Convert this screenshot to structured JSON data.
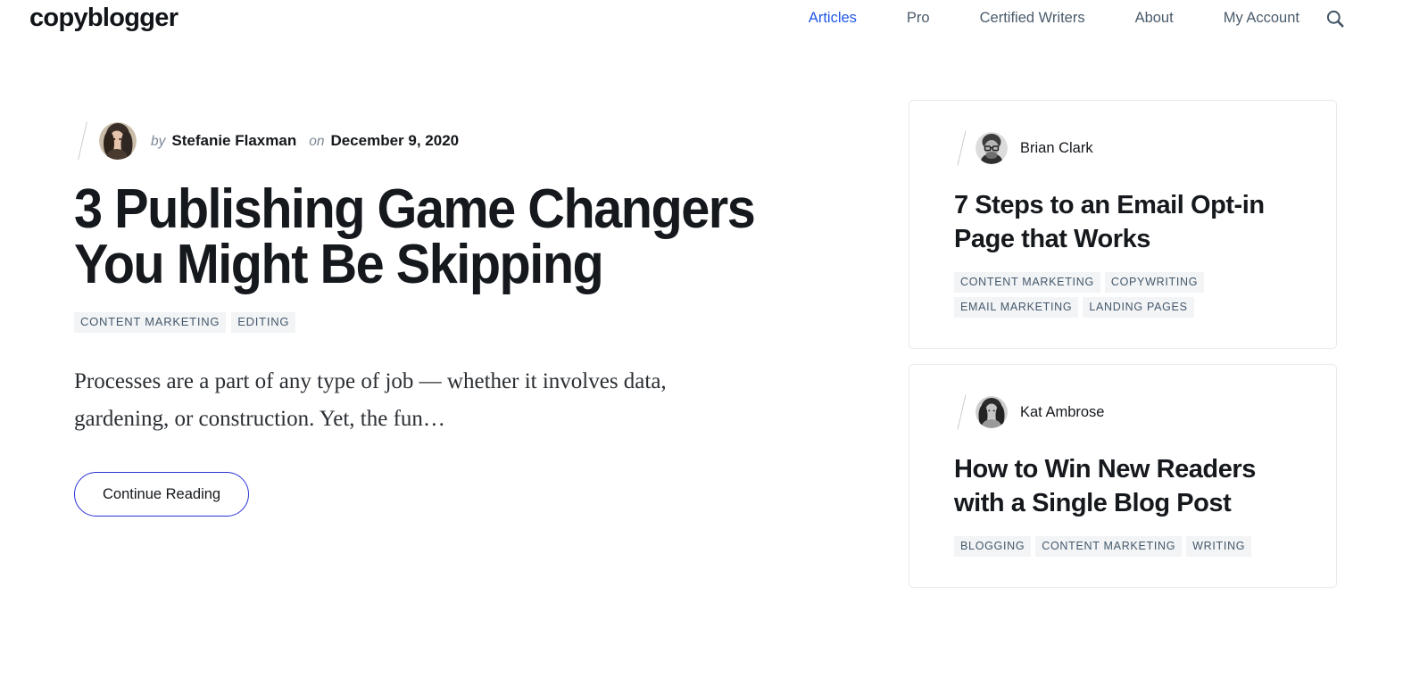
{
  "header": {
    "brand": "copyblogger",
    "nav": [
      {
        "label": "Articles",
        "active": true
      },
      {
        "label": "Pro",
        "active": false
      },
      {
        "label": "Certified Writers",
        "active": false
      },
      {
        "label": "About",
        "active": false
      },
      {
        "label": "My Account",
        "active": false
      }
    ],
    "search_icon": "search-icon"
  },
  "featured": {
    "byline": {
      "by_label": "by",
      "author": "Stefanie Flaxman",
      "on_label": "on",
      "date": "December 9, 2020"
    },
    "title": "3 Publishing Game Changers You Might Be Skipping",
    "tags": [
      "CONTENT MARKETING",
      "EDITING"
    ],
    "excerpt": "Processes are a part of any type of job — whether it involves data, gardening, or construction. Yet, the fun…",
    "cta_label": "Continue Reading"
  },
  "sidebar": {
    "cards": [
      {
        "author": "Brian Clark",
        "title": "7 Steps to an Email Opt-in Page that Works",
        "tags": [
          "CONTENT MARKETING",
          "COPYWRITING",
          "EMAIL MARKETING",
          "LANDING PAGES"
        ]
      },
      {
        "author": "Kat Ambrose",
        "title": "How to Win New Readers with a Single Blog Post",
        "tags": [
          "BLOGGING",
          "CONTENT MARKETING",
          "WRITING"
        ]
      }
    ]
  },
  "colors": {
    "accent_blue": "#2157e8",
    "cta_border": "#2b33d6",
    "nav_text": "#4a5b6b",
    "tag_bg": "#f2f4f6",
    "tag_text": "#44586b",
    "card_border": "#e8eaec",
    "text": "#15181c"
  }
}
